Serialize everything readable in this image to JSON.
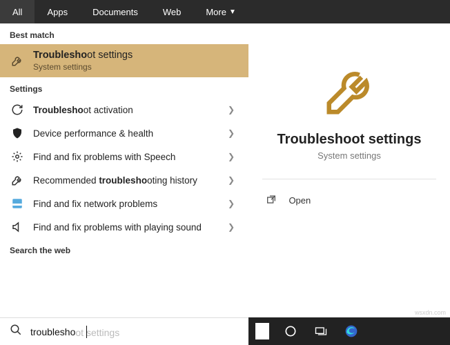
{
  "tabs": {
    "all": "All",
    "apps": "Apps",
    "documents": "Documents",
    "web": "Web",
    "more": "More"
  },
  "best_match_header": "Best match",
  "best_match": {
    "title_pre": "Troublesho",
    "title_post": "ot settings",
    "sub": "System settings"
  },
  "settings_header": "Settings",
  "items": {
    "activation_pre": "Troublesho",
    "activation_post": "ot activation",
    "health": "Device performance & health",
    "speech": "Find and fix problems with Speech",
    "reco_pre": "Recommended ",
    "reco_bold": "troublesho",
    "reco_post": "oting history",
    "network": "Find and fix network problems",
    "sound": "Find and fix problems with playing sound"
  },
  "web_header": "Search the web",
  "hero": {
    "title": "Troubleshoot settings",
    "sub": "System settings"
  },
  "action_open": "Open",
  "search": {
    "typed": "troublesho",
    "suggest": "ot settings"
  },
  "watermark": "wsxdn.com"
}
